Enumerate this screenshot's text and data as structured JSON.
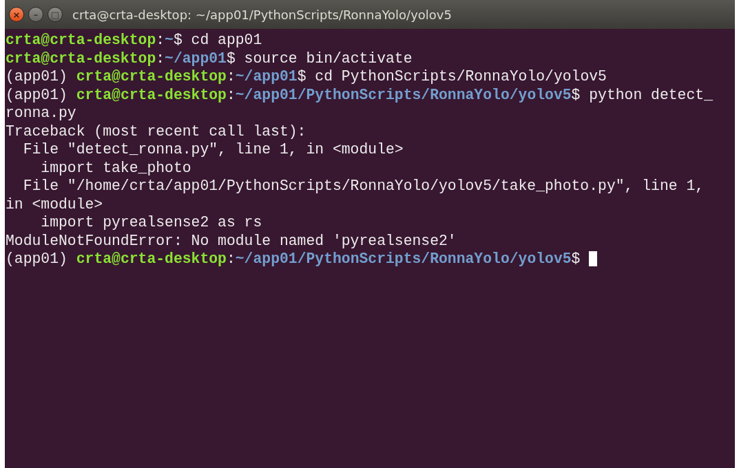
{
  "window": {
    "title": "crta@crta-desktop: ~/app01/PythonScripts/RonnaYolo/yolov5",
    "buttons": [
      {
        "kind": "close",
        "label": "×"
      },
      {
        "kind": "minimize",
        "label": "–"
      },
      {
        "kind": "maximize",
        "label": "□"
      }
    ]
  },
  "terminal": {
    "lines": [
      {
        "segments": [
          {
            "kind": "user",
            "text": "crta@crta-desktop"
          },
          {
            "kind": "plain",
            "text": ":"
          },
          {
            "kind": "path",
            "text": "~"
          },
          {
            "kind": "plain",
            "text": "$ cd app01"
          }
        ]
      },
      {
        "segments": [
          {
            "kind": "user",
            "text": "crta@crta-desktop"
          },
          {
            "kind": "plain",
            "text": ":"
          },
          {
            "kind": "path",
            "text": "~/app01"
          },
          {
            "kind": "plain",
            "text": "$ source bin/activate"
          }
        ]
      },
      {
        "segments": [
          {
            "kind": "plain",
            "text": "(app01) "
          },
          {
            "kind": "user",
            "text": "crta@crta-desktop"
          },
          {
            "kind": "plain",
            "text": ":"
          },
          {
            "kind": "path",
            "text": "~/app01"
          },
          {
            "kind": "plain",
            "text": "$ cd PythonScripts/RonnaYolo/yolov5"
          }
        ]
      },
      {
        "segments": [
          {
            "kind": "plain",
            "text": "(app01) "
          },
          {
            "kind": "user",
            "text": "crta@crta-desktop"
          },
          {
            "kind": "plain",
            "text": ":"
          },
          {
            "kind": "path",
            "text": "~/app01/PythonScripts/RonnaYolo/yolov5"
          },
          {
            "kind": "plain",
            "text": "$ python detect_"
          }
        ]
      },
      {
        "segments": [
          {
            "kind": "plain",
            "text": "ronna.py"
          }
        ]
      },
      {
        "segments": [
          {
            "kind": "plain",
            "text": "Traceback (most recent call last):"
          }
        ]
      },
      {
        "segments": [
          {
            "kind": "plain",
            "text": "  File \"detect_ronna.py\", line 1, in <module>"
          }
        ]
      },
      {
        "segments": [
          {
            "kind": "plain",
            "text": "    import take_photo"
          }
        ]
      },
      {
        "segments": [
          {
            "kind": "plain",
            "text": "  File \"/home/crta/app01/PythonScripts/RonnaYolo/yolov5/take_photo.py\", line 1,"
          }
        ]
      },
      {
        "segments": [
          {
            "kind": "plain",
            "text": "in <module>"
          }
        ]
      },
      {
        "segments": [
          {
            "kind": "plain",
            "text": "    import pyrealsense2 as rs"
          }
        ]
      },
      {
        "segments": [
          {
            "kind": "plain",
            "text": "ModuleNotFoundError: No module named 'pyrealsense2'"
          }
        ]
      },
      {
        "segments": [
          {
            "kind": "plain",
            "text": "(app01) "
          },
          {
            "kind": "user",
            "text": "crta@crta-desktop"
          },
          {
            "kind": "plain",
            "text": ":"
          },
          {
            "kind": "path",
            "text": "~/app01/PythonScripts/RonnaYolo/yolov5"
          },
          {
            "kind": "plain",
            "text": "$ "
          }
        ],
        "cursor": true
      }
    ]
  }
}
